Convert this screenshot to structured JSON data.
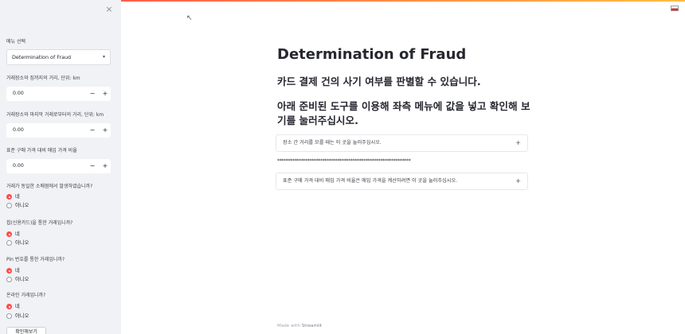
{
  "sidebar": {
    "close_icon": "×",
    "menu_label": "메뉴 선택",
    "menu_value": "Determination of Fraud",
    "fields": [
      {
        "label": "거래장소와 집까지의 거리, 단위: km",
        "value": "0.00",
        "minus": "−",
        "plus": "+"
      },
      {
        "label": "거래장소와 마지막 거래로부터의 거리, 단위: km",
        "value": "0.00",
        "minus": "−",
        "plus": "+"
      },
      {
        "label": "표준 구매 가격 대비 매입 가격 비율",
        "value": "0.00",
        "minus": "−",
        "plus": "+"
      }
    ],
    "questions": [
      {
        "label": "거래가 동일한 소매점에서 발생하였습니까?",
        "opt_yes": "네",
        "opt_no": "아니오"
      },
      {
        "label": "칩(신용카드)을 통한 거래입니까?",
        "opt_yes": "네",
        "opt_no": "아니오"
      },
      {
        "label": "Pin 번호를 통한 거래입니까?",
        "opt_yes": "네",
        "opt_no": "아니오"
      },
      {
        "label": "온라인 거래입니까?",
        "opt_yes": "네",
        "opt_no": "아니오"
      }
    ],
    "confirm_button": "확인해보기"
  },
  "main": {
    "title": "Determination of Fraud",
    "subtitle1": "카드 결제 건의 사기 여부를 판별할 수 있습니다.",
    "subtitle2": "아래 준비된 도구를 이용해 좌측 메뉴에 값을 넣고 확인해 보기를 눌러주십시오.",
    "expander1": "장소 간 거리를 모를 때는 이 곳을 눌러주십시오.",
    "separator": "**************************************************************",
    "expander2": "표준 구매 가격 대비 매입 가격 비율은 매입 가격을 계산하려면 이 곳을 눌러주십시오.",
    "footer_prefix": "Made with ",
    "footer_brand": "Streamlit"
  },
  "colors": {
    "accent": "#ff4b4b",
    "sidebar_bg": "#f0f2f6"
  }
}
